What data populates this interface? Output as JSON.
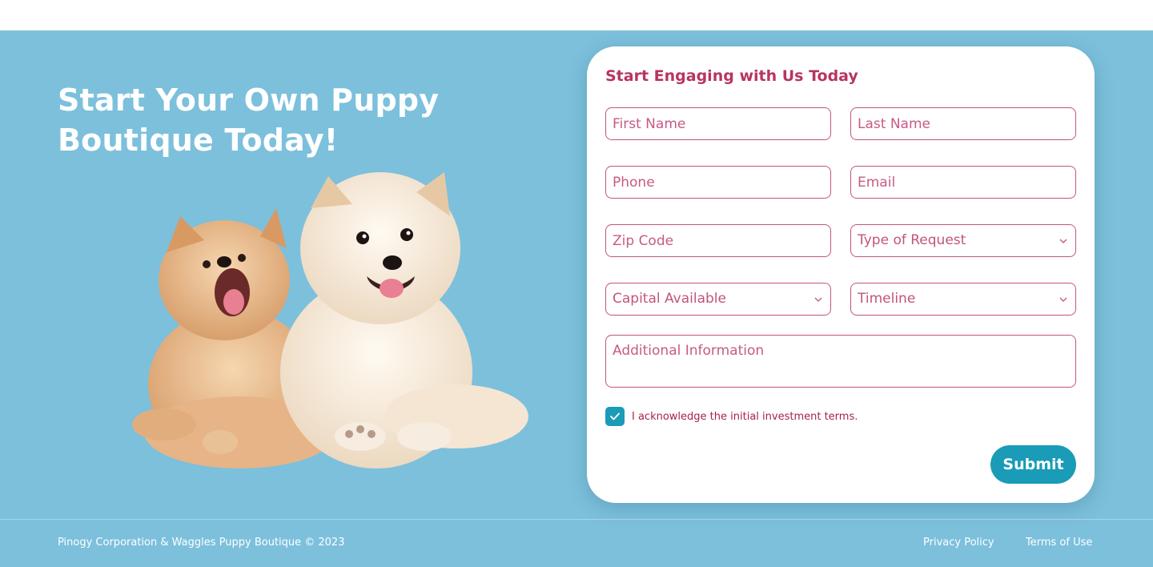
{
  "hero": {
    "headline": "Start Your Own Puppy Boutique Today!",
    "background_color": "#7cc0dc"
  },
  "form": {
    "title": "Start Engaging with Us Today",
    "first_name_placeholder": "First Name",
    "last_name_placeholder": "Last Name",
    "phone_placeholder": "Phone",
    "email_placeholder": "Email",
    "zip_placeholder": "Zip Code",
    "request_type_label": "Type of Request",
    "capital_label": "Capital Available",
    "timeline_label": "Timeline",
    "additional_info_placeholder": "Additional Information",
    "acknowledge_label": "I acknowledge the initial investment terms.",
    "acknowledge_checked": true,
    "submit_label": "Submit",
    "accent_color": "#1a9bb8",
    "field_color": "#c2547e"
  },
  "footer": {
    "copyright": "Pinogy Corporation & Waggles Puppy Boutique © 2023",
    "privacy_link": "Privacy Policy",
    "terms_link": "Terms of Use"
  }
}
